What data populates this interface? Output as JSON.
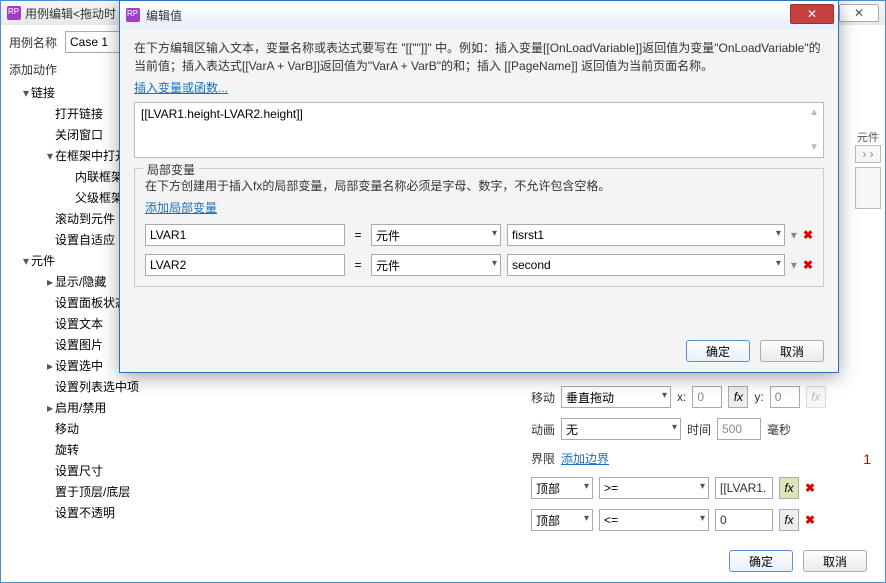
{
  "back": {
    "title": "用例编辑<拖动时",
    "close_x": "✕",
    "case_label": "用例名称",
    "case_value": "Case 1",
    "add_action": "添加动作",
    "tree": [
      {
        "arrow": "open",
        "lvl": 1,
        "label": "链接"
      },
      {
        "arrow": "none",
        "lvl": 2,
        "label": "打开链接"
      },
      {
        "arrow": "none",
        "lvl": 2,
        "label": "关闭窗口"
      },
      {
        "arrow": "open",
        "lvl": 2,
        "label": "在框架中打开"
      },
      {
        "arrow": "none",
        "lvl": 3,
        "label": "内联框架"
      },
      {
        "arrow": "none",
        "lvl": 3,
        "label": "父级框架"
      },
      {
        "arrow": "none",
        "lvl": 2,
        "label": "滚动到元件"
      },
      {
        "arrow": "none",
        "lvl": 2,
        "label": "设置自适应"
      },
      {
        "arrow": "open",
        "lvl": 1,
        "label": "元件"
      },
      {
        "arrow": "closed",
        "lvl": 2,
        "label": "显示/隐藏"
      },
      {
        "arrow": "none",
        "lvl": 2,
        "label": "设置面板状态"
      },
      {
        "arrow": "none",
        "lvl": 2,
        "label": "设置文本"
      },
      {
        "arrow": "none",
        "lvl": 2,
        "label": "设置图片"
      },
      {
        "arrow": "closed",
        "lvl": 2,
        "label": "设置选中"
      },
      {
        "arrow": "none",
        "lvl": 2,
        "label": "设置列表选中项"
      },
      {
        "arrow": "closed",
        "lvl": 2,
        "label": "启用/禁用"
      },
      {
        "arrow": "none",
        "lvl": 2,
        "label": "移动"
      },
      {
        "arrow": "none",
        "lvl": 2,
        "label": "旋转"
      },
      {
        "arrow": "none",
        "lvl": 2,
        "label": "设置尺寸"
      },
      {
        "arrow": "none",
        "lvl": 2,
        "label": "置于顶层/底层"
      },
      {
        "arrow": "none",
        "lvl": 2,
        "label": "设置不透明"
      }
    ],
    "move_label": "移动",
    "move_type": "垂直拖动",
    "x_label": "x:",
    "x_val": "0",
    "fx": "fx",
    "y_label": "y:",
    "y_val": "0",
    "anim_label": "动画",
    "anim_val": "无",
    "time_label": "时间",
    "time_val": "500",
    "ms": "毫秒",
    "bound_label": "界限",
    "add_bound": "添加边界",
    "one": "1",
    "b1_side": "顶部",
    "b1_op": ">=",
    "b1_val": "[[LVAR1.",
    "b2_side": "顶部",
    "b2_op": "<=",
    "b2_val": "0",
    "ok": "确定",
    "cancel": "取消",
    "edge_txt": "元件"
  },
  "modal": {
    "title": "编辑值",
    "desc": "在下方编辑区输入文本，变量名称或表达式要写在 \"[[\"\"]]\" 中。例如：插入变量[[OnLoadVariable]]返回值为变量\"OnLoadVariable\"的当前值；插入表达式[[VarA + VarB]]返回值为\"VarA + VarB\"的和；插入 [[PageName]] 返回值为当前页面名称。",
    "insert_link": "插入变量或函数...",
    "expr": "[[LVAR1.height-LVAR2.height]]",
    "group_title": "局部变量",
    "group_desc": "在下方创建用于插入fx的局部变量，局部变量名称必须是字母、数字，不允许包含空格。",
    "add_local": "添加局部变量",
    "eq": "=",
    "type": "元件",
    "v1_name": "LVAR1",
    "v1_val": "fisrst1",
    "v2_name": "LVAR2",
    "v2_val": "second",
    "ok": "确定",
    "cancel": "取消",
    "x": "✕"
  }
}
